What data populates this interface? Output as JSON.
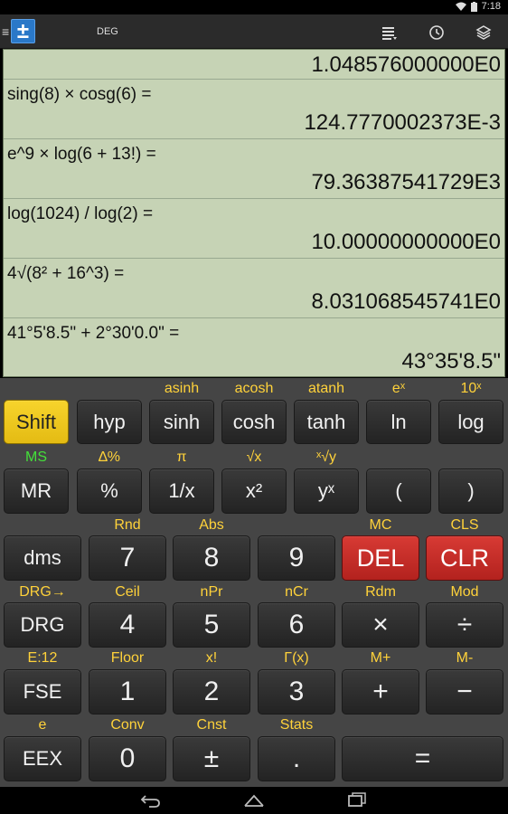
{
  "status": {
    "time": "7:18"
  },
  "actionbar": {
    "mode": "DEG",
    "logo_glyph": "±",
    "icons": [
      "list-icon",
      "clock-icon",
      "layers-icon"
    ]
  },
  "history": [
    {
      "expr": "",
      "result": "1.048576000000E0"
    },
    {
      "expr": "sing(8) × cosg(6) =",
      "result": "124.7770002373E-3"
    },
    {
      "expr": "e^9 × log(6 + 13!) =",
      "result": "79.36387541729E3"
    },
    {
      "expr": "log(1024) / log(2) =",
      "result": "10.00000000000E0"
    },
    {
      "expr": "4√(8² + 16^3) =",
      "result": "8.031068545741E0"
    },
    {
      "expr": "41°5'8.5\" + 2°30'0.0\" =",
      "result": "43°35'8.5\""
    }
  ],
  "keys": {
    "shift": "Shift",
    "hyp": "hyp",
    "sinh": "sinh",
    "cosh": "cosh",
    "tanh": "tanh",
    "ln": "ln",
    "log": "log",
    "mr": "MR",
    "percent": "%",
    "reciprocal": "1/x",
    "square": "x²",
    "power": "yˣ",
    "lparen": "(",
    "rparen": ")",
    "dms": "dms",
    "seven": "7",
    "eight": "8",
    "nine": "9",
    "del": "DEL",
    "clr": "CLR",
    "drg": "DRG",
    "four": "4",
    "five": "5",
    "six": "6",
    "multiply": "×",
    "divide": "÷",
    "fse": "FSE",
    "one": "1",
    "two": "2",
    "three": "3",
    "plus": "+",
    "minus": "−",
    "eex": "EEX",
    "zero": "0",
    "plusminus": "±",
    "dot": ".",
    "equals": "="
  },
  "shift_labels": {
    "asinh": "asinh",
    "acosh": "acosh",
    "atanh": "atanh",
    "exp": "eˣ",
    "tenx": "10ˣ",
    "ms": "MS",
    "delta_percent": "∆%",
    "pi": "π",
    "sqrt": "√x",
    "xroot": "ˣ√y",
    "rnd": "Rnd",
    "abs": "Abs",
    "mc": "MC",
    "cls": "CLS",
    "drg_arrow": "DRG→",
    "ceil": "Ceil",
    "npr": "nPr",
    "ncr": "nCr",
    "rdm": "Rdm",
    "mod": "Mod",
    "e12": "E:12",
    "floor": "Floor",
    "factorial": "x!",
    "gamma": "Γ(x)",
    "mplus": "M+",
    "mminus": "M-",
    "e": "e",
    "conv": "Conv",
    "cnst": "Cnst",
    "stats": "Stats"
  },
  "colors": {
    "shift_key": "#f0cc20",
    "del_key": "#c52c28",
    "shift_label": "#ffd23a",
    "memory_label": "#44e03a",
    "display_bg": "#c6d3b5"
  }
}
